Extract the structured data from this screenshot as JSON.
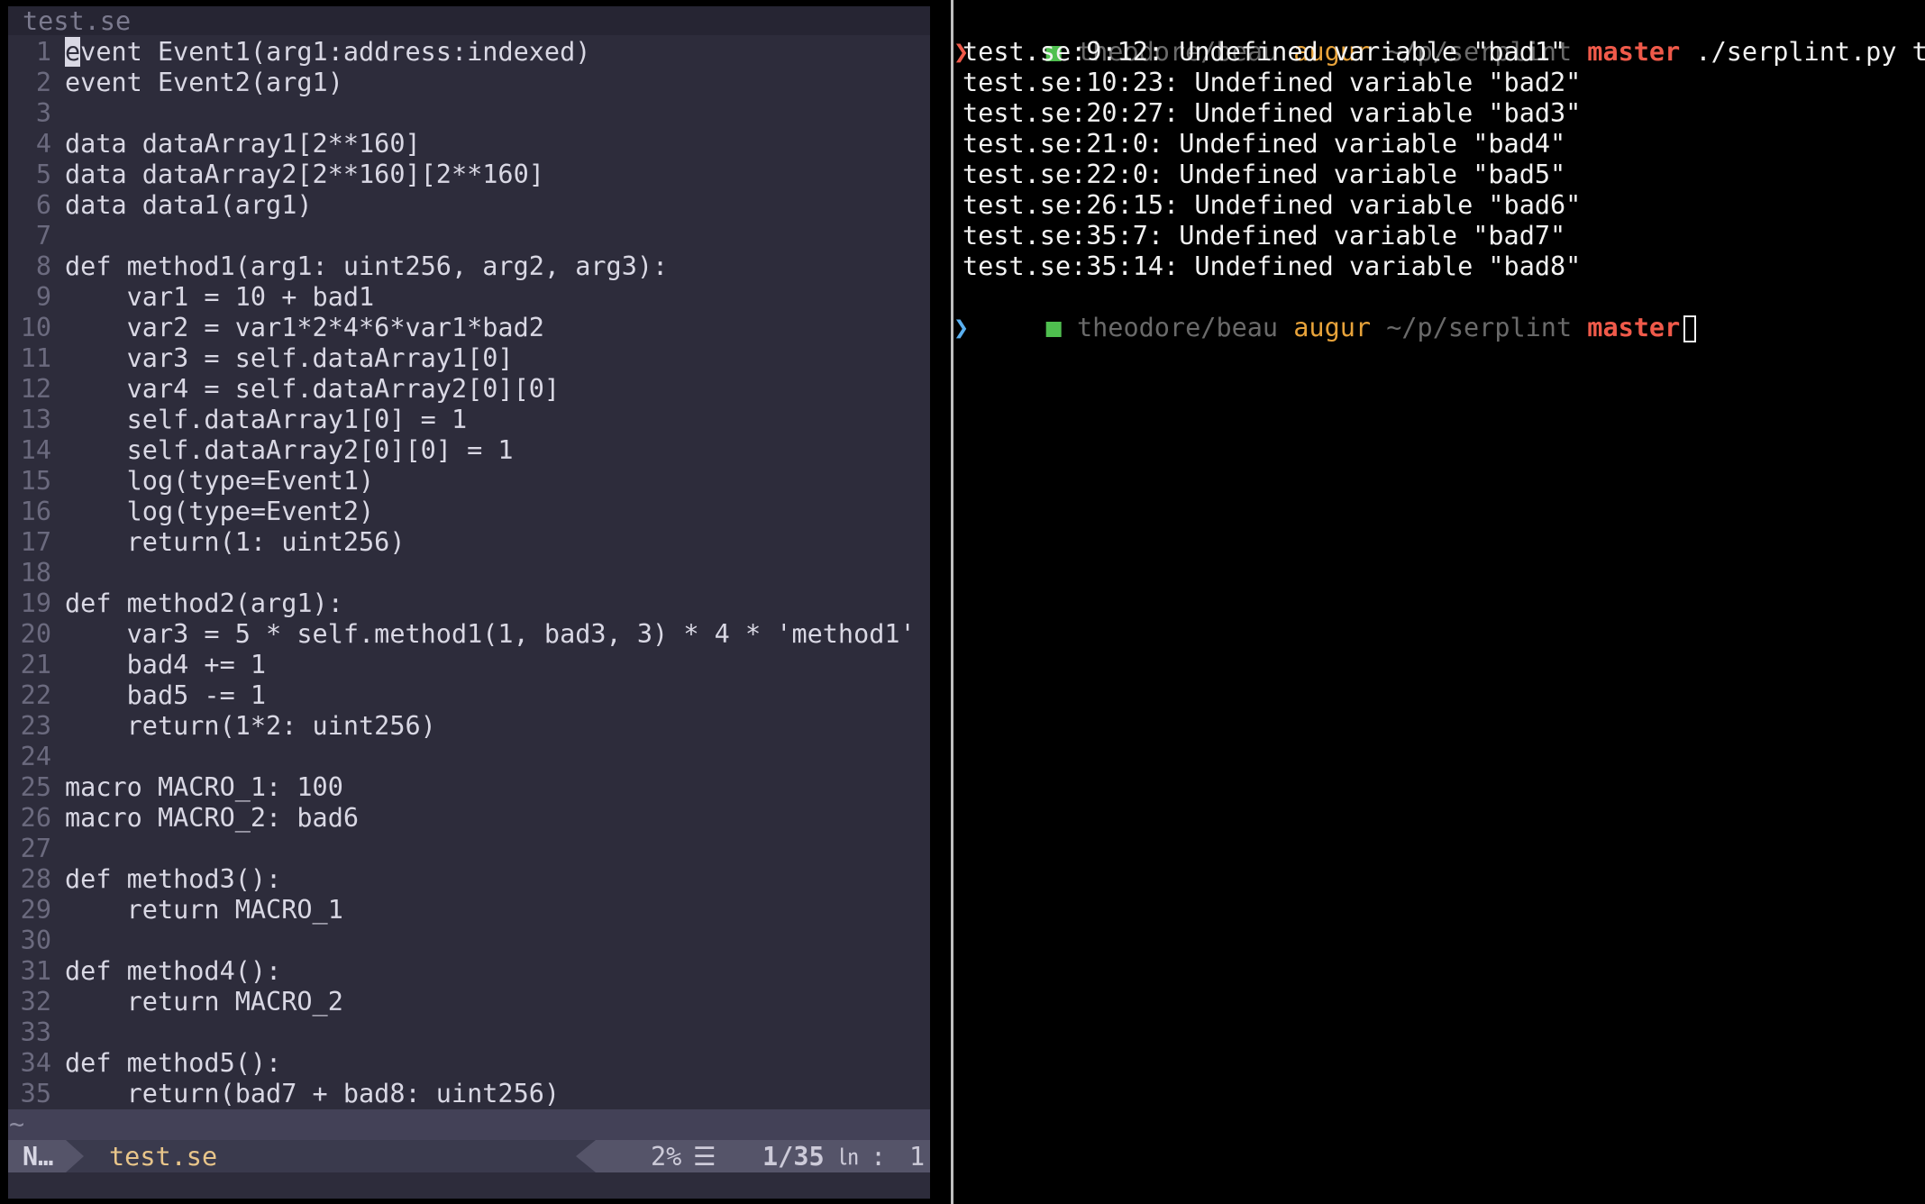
{
  "editor": {
    "tab_title": "test.se",
    "lines": [
      {
        "n": "1",
        "text": "event Event1(arg1:address:indexed)"
      },
      {
        "n": "2",
        "text": "event Event2(arg1)"
      },
      {
        "n": "3",
        "text": ""
      },
      {
        "n": "4",
        "text": "data dataArray1[2**160]"
      },
      {
        "n": "5",
        "text": "data dataArray2[2**160][2**160]"
      },
      {
        "n": "6",
        "text": "data data1(arg1)"
      },
      {
        "n": "7",
        "text": ""
      },
      {
        "n": "8",
        "text": "def method1(arg1: uint256, arg2, arg3):"
      },
      {
        "n": "9",
        "text": "    var1 = 10 + bad1"
      },
      {
        "n": "10",
        "text": "    var2 = var1*2*4*6*var1*bad2"
      },
      {
        "n": "11",
        "text": "    var3 = self.dataArray1[0]"
      },
      {
        "n": "12",
        "text": "    var4 = self.dataArray2[0][0]"
      },
      {
        "n": "13",
        "text": "    self.dataArray1[0] = 1"
      },
      {
        "n": "14",
        "text": "    self.dataArray2[0][0] = 1"
      },
      {
        "n": "15",
        "text": "    log(type=Event1)"
      },
      {
        "n": "16",
        "text": "    log(type=Event2)"
      },
      {
        "n": "17",
        "text": "    return(1: uint256)"
      },
      {
        "n": "18",
        "text": ""
      },
      {
        "n": "19",
        "text": "def method2(arg1):"
      },
      {
        "n": "20",
        "text": "    var3 = 5 * self.method1(1, bad3, 3) * 4 * 'method1'"
      },
      {
        "n": "21",
        "text": "    bad4 += 1"
      },
      {
        "n": "22",
        "text": "    bad5 -= 1"
      },
      {
        "n": "23",
        "text": "    return(1*2: uint256)"
      },
      {
        "n": "24",
        "text": ""
      },
      {
        "n": "25",
        "text": "macro MACRO_1: 100"
      },
      {
        "n": "26",
        "text": "macro MACRO_2: bad6"
      },
      {
        "n": "27",
        "text": ""
      },
      {
        "n": "28",
        "text": "def method3():"
      },
      {
        "n": "29",
        "text": "    return MACRO_1"
      },
      {
        "n": "30",
        "text": ""
      },
      {
        "n": "31",
        "text": "def method4():"
      },
      {
        "n": "32",
        "text": "    return MACRO_2"
      },
      {
        "n": "33",
        "text": ""
      },
      {
        "n": "34",
        "text": "def method5():"
      },
      {
        "n": "35",
        "text": "    return(bad7 + bad8: uint256)"
      }
    ],
    "end_of_buffer": "~",
    "statusline": {
      "mode": "N…",
      "filename": "test.se",
      "percent": "2%",
      "menu_icon": "☰",
      "position": "1/35",
      "ln_icon": "㏑",
      "colon": ":",
      "column": "1"
    }
  },
  "terminal": {
    "prompt": {
      "arrow": "❯",
      "square": "■",
      "user": "theodore",
      "sep": "/",
      "machine": "beau",
      "host": "augur",
      "path": "~/p/serplint",
      "branch": "master"
    },
    "command": "./serplint.py test.se",
    "output": [
      "test.se:9:12: Undefined variable \"bad1\"",
      "test.se:10:23: Undefined variable \"bad2\"",
      "test.se:20:27: Undefined variable \"bad3\"",
      "test.se:21:0: Undefined variable \"bad4\"",
      "test.se:22:0: Undefined variable \"bad5\"",
      "test.se:26:15: Undefined variable \"bad6\"",
      "test.se:35:7: Undefined variable \"bad7\"",
      "test.se:35:14: Undefined variable \"bad8\""
    ],
    "colors": {
      "arrow_first": "#f05a4a",
      "arrow_second": "#5ab0f0"
    }
  }
}
